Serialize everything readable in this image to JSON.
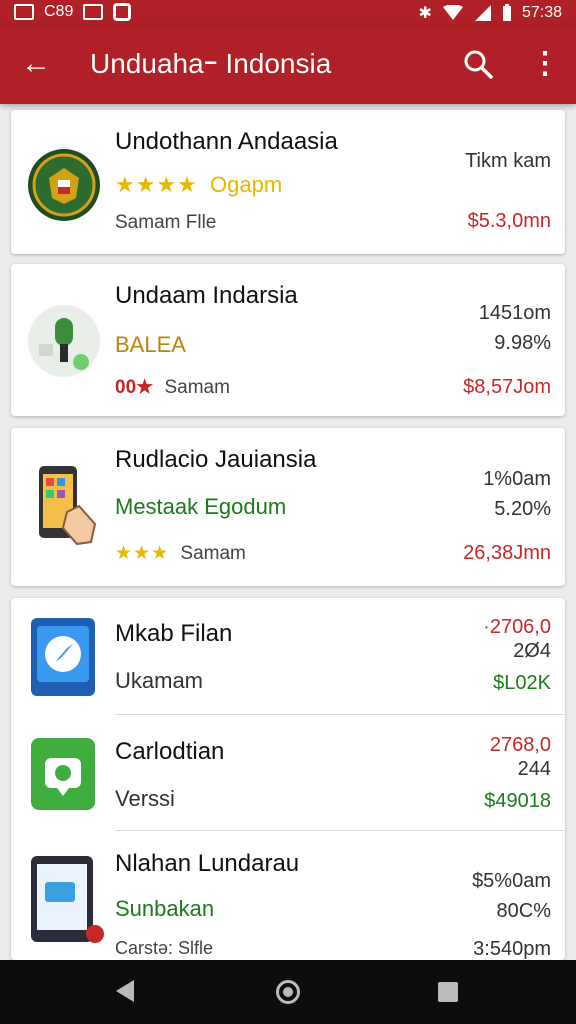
{
  "status_bar": {
    "left_text": "C89",
    "time": "57:38"
  },
  "app_bar": {
    "back_glyph": "←",
    "title": "Unduahaｰ Indonsia",
    "more_glyph": "⋮"
  },
  "items": [
    {
      "title": "Undothann Andaasia",
      "stars": "★★★★",
      "subtitle": "Ogapm",
      "meta": "Samam Flle",
      "right_top": "Tikm kam",
      "price": "$5.3,0mn"
    },
    {
      "title": "Undaam Indarsia",
      "subtitle": "BALEA",
      "rating_label": "00★",
      "meta": "Samam",
      "right_top": "1451om",
      "right_mid": "9.98%",
      "price": "$8,57Jom"
    },
    {
      "title": "Rudlacio Jauiansia",
      "subtitle": "Mestaak Egodum",
      "stars": "★★★",
      "meta": "Samam",
      "right_top": "1%0am",
      "right_mid": "5.20%",
      "price": "26,38Jmn"
    }
  ],
  "list": [
    {
      "title": "Mkab Filan",
      "subtitle": "Ukamam",
      "right_top": "·2706,0",
      "right_mid": "2Ø4",
      "price": "$L02K"
    },
    {
      "title": "Carlodtian",
      "subtitle": "Verssi",
      "right_top": "2768,0",
      "right_mid": "244",
      "price": "$49018"
    },
    {
      "title": "Nlahan Lundarau",
      "subtitle": "Sunbakan",
      "meta": "Carstǝ: Slfle",
      "right_top": "$5%0am",
      "right_mid": "80C%",
      "price": "3:540pm"
    }
  ],
  "colors": {
    "brand": "#b02127",
    "price_red": "#c62828",
    "price_green": "#1b7a1b",
    "star": "#e6b800"
  }
}
